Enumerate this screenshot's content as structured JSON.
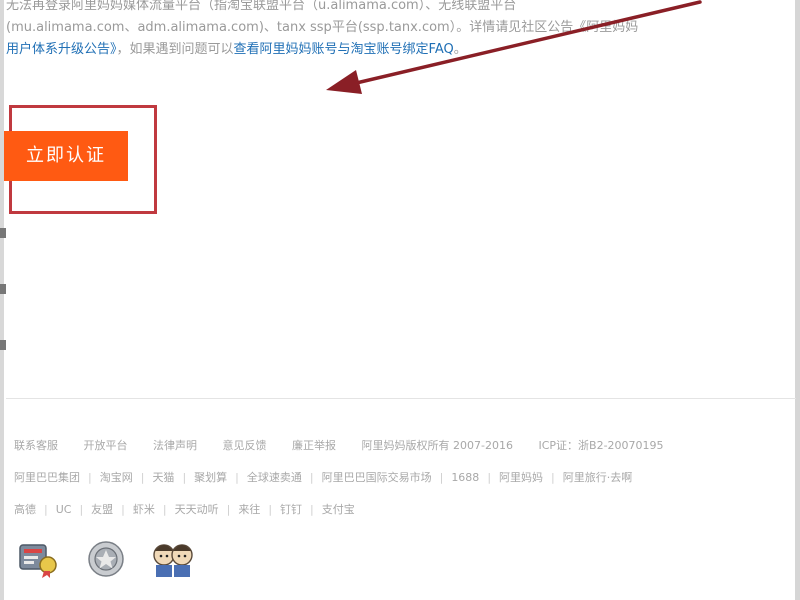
{
  "notice": {
    "line1": "无法再登录阿里妈妈媒体流量平台（指淘宝联盟平台（u.alimama.com）、无线联盟平台",
    "line2": "(mu.alimama.com、adm.alimama.com)、tanx ssp平台(ssp.tanx.com）。详情请见社区公告《阿里妈妈",
    "line3_link1": "用户体系升级公告》",
    "line3_mid": "，如果遇到问题可以",
    "line3_link2": "查看阿里妈妈账号与淘宝账号绑定FAQ",
    "line3_end": "。"
  },
  "cta": {
    "label": "立即认证"
  },
  "footer": {
    "row1": [
      "联系客服",
      "开放平台",
      "法律声明",
      "意见反馈",
      "廉正举报",
      "阿里妈妈版权所有 2007-2016",
      "ICP证：浙B2-20070195"
    ],
    "row2": [
      "阿里巴巴集团",
      "淘宝网",
      "天猫",
      "聚划算",
      "全球速卖通",
      "阿里巴巴国际交易市场",
      "1688",
      "阿里妈妈",
      "阿里旅行·去啊"
    ],
    "row3": [
      "高德",
      "UC",
      "友盟",
      "虾米",
      "天天动听",
      "来往",
      "钉钉",
      "支付宝"
    ]
  },
  "colors": {
    "cta": "#ff5a12",
    "highlight": "#c0393f",
    "arrow": "#8a1f26",
    "link": "#1f6fb5"
  },
  "icons": [
    "certificate-badge-icon",
    "police-badge-icon",
    "cartoon-badge-icon"
  ]
}
